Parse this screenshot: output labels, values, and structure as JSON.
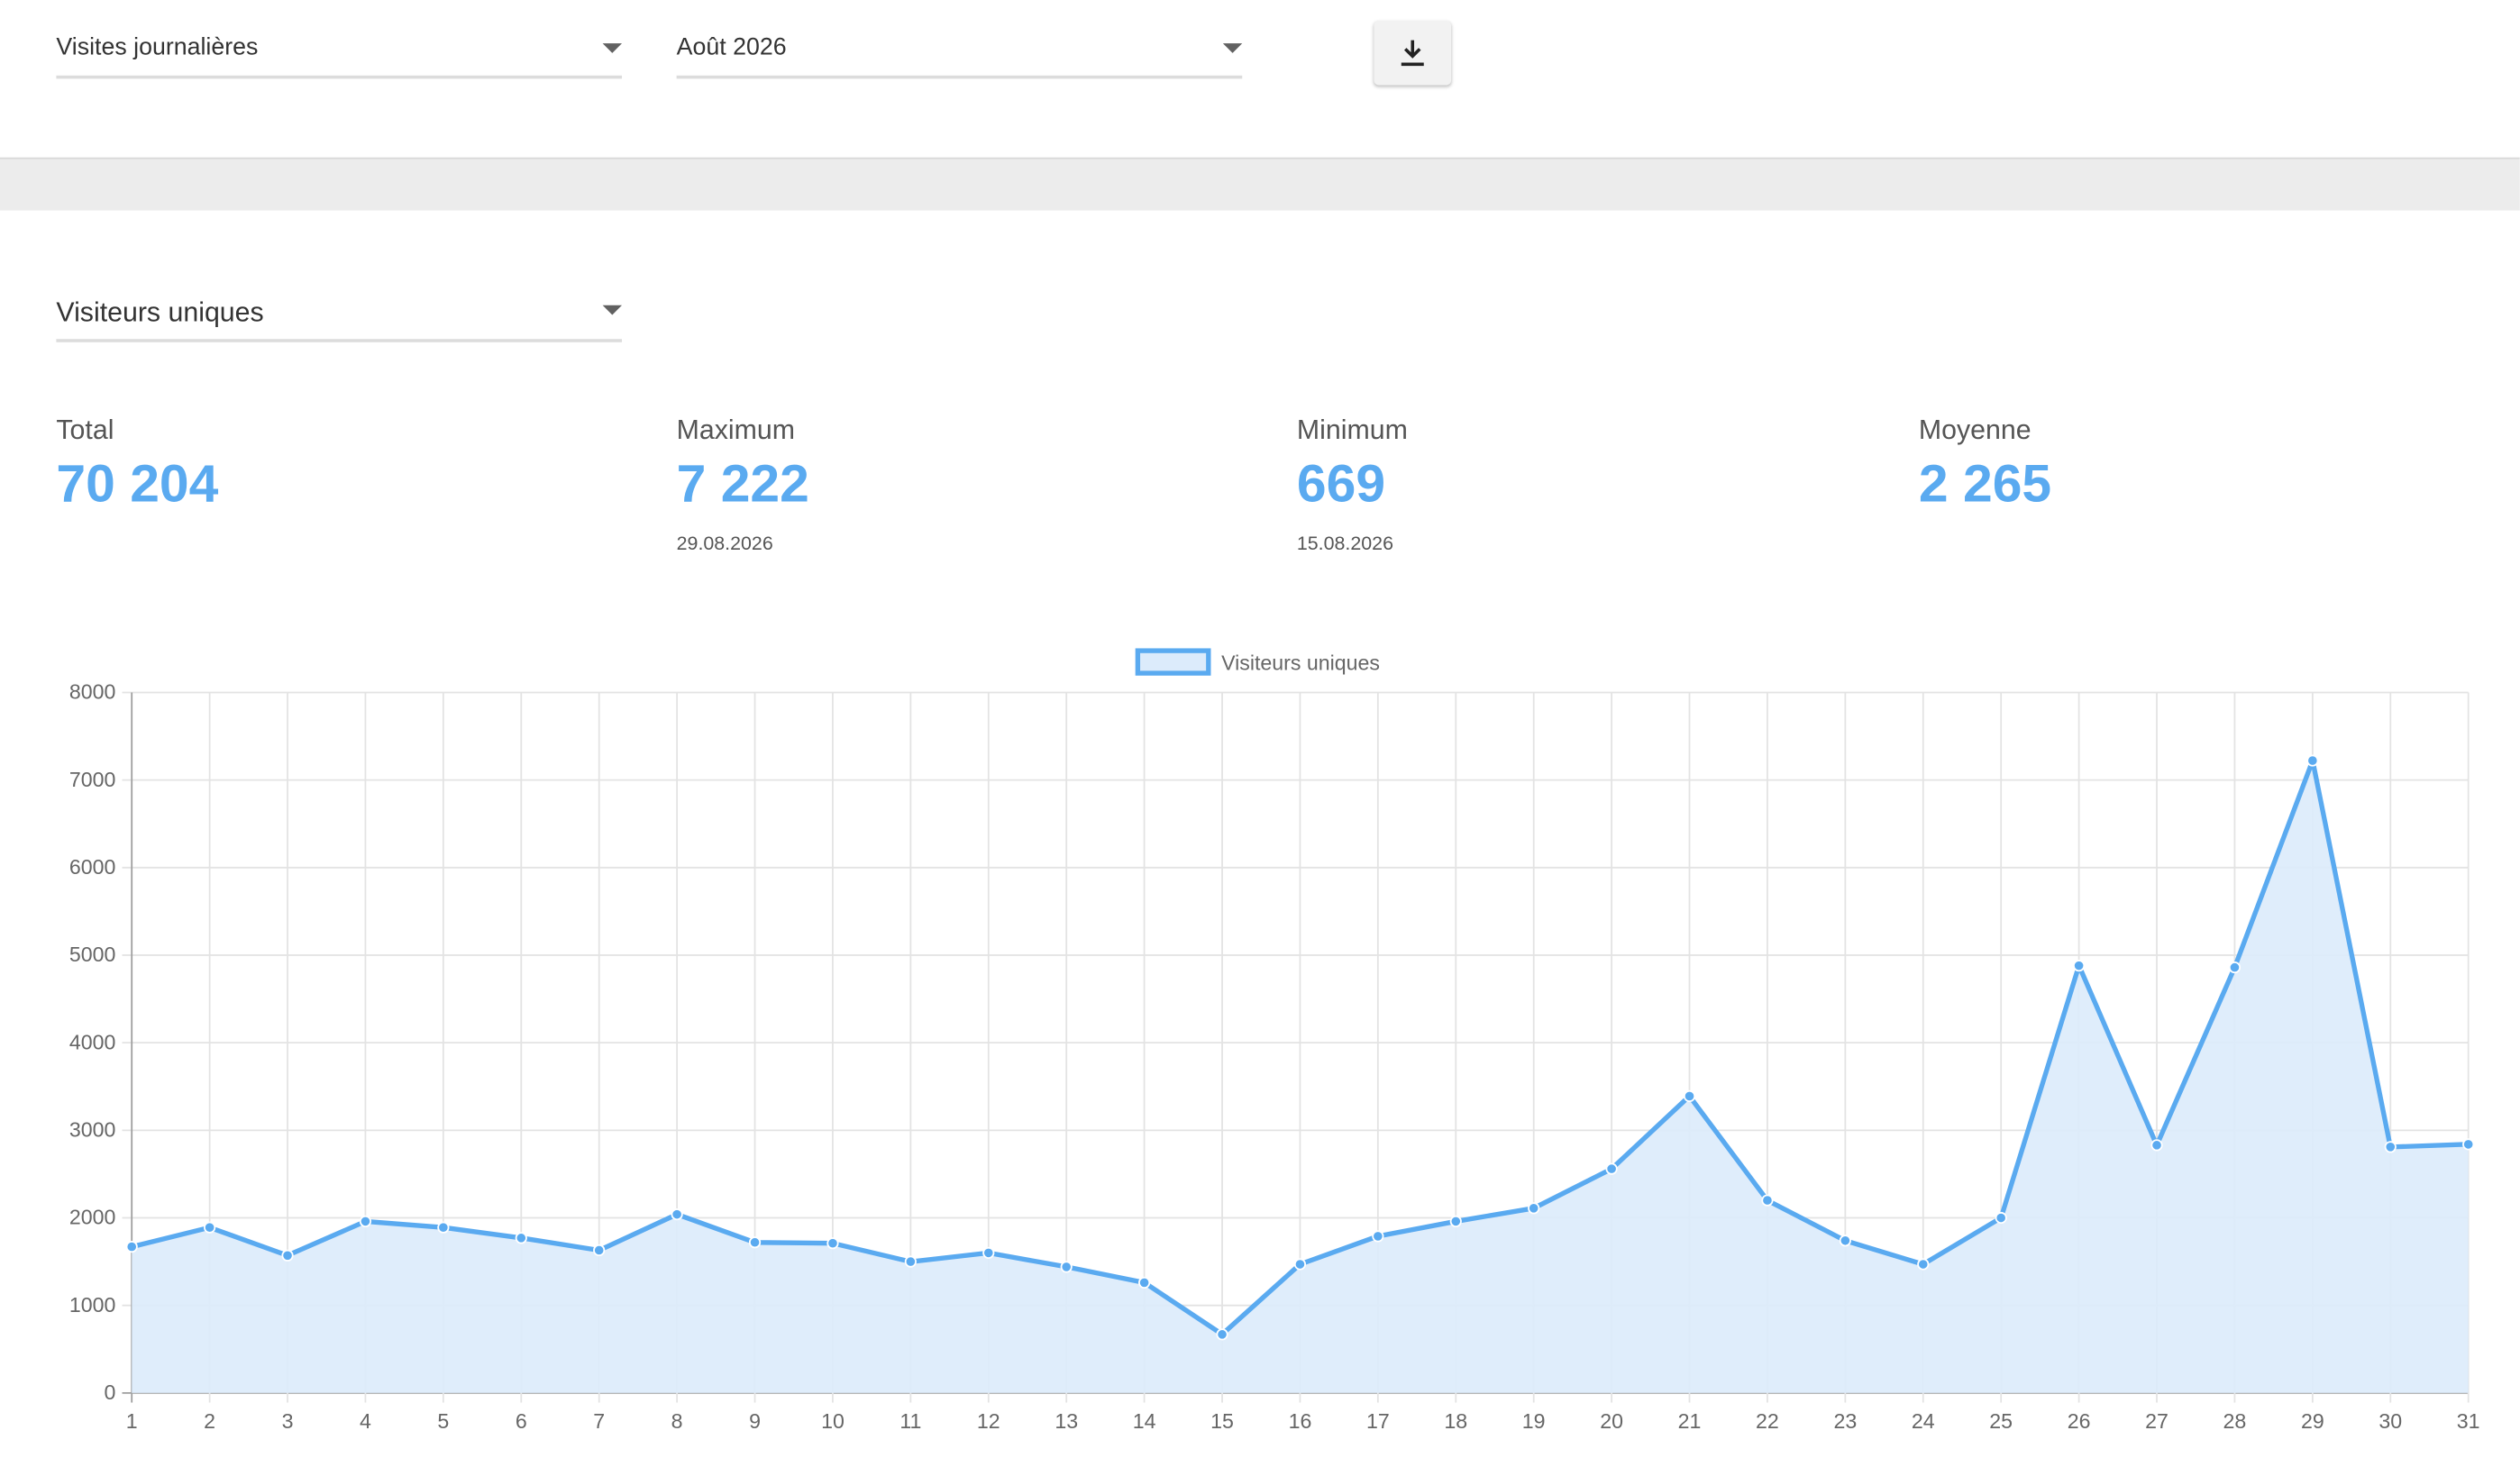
{
  "header": {
    "report_select": "Visites journalières",
    "period_select": "Août 2026",
    "download_icon": "download-icon"
  },
  "metric_select": "Visiteurs uniques",
  "stats": [
    {
      "label": "Total",
      "value": "70 204",
      "date": ""
    },
    {
      "label": "Maximum",
      "value": "7 222",
      "date": "29.08.2026"
    },
    {
      "label": "Minimum",
      "value": "669",
      "date": "15.08.2026"
    },
    {
      "label": "Moyenne",
      "value": "2 265",
      "date": ""
    }
  ],
  "colors": {
    "accent": "#5aaaf0",
    "fill": "#dcebfb",
    "grid": "#e3e3e3"
  },
  "chart_data": {
    "type": "area",
    "categories": [
      1,
      2,
      3,
      4,
      5,
      6,
      7,
      8,
      9,
      10,
      11,
      12,
      13,
      14,
      15,
      16,
      17,
      18,
      19,
      20,
      21,
      22,
      23,
      24,
      25,
      26,
      27,
      28,
      29,
      30,
      31
    ],
    "series": [
      {
        "name": "Visiteurs uniques",
        "values": [
          1670,
          1890,
          1570,
          1960,
          1890,
          1770,
          1630,
          2040,
          1720,
          1710,
          1500,
          1600,
          1440,
          1260,
          669,
          1470,
          1790,
          1960,
          2110,
          2560,
          3390,
          2200,
          1740,
          1470,
          2000,
          4880,
          2830,
          4860,
          7222,
          2810,
          2840
        ]
      }
    ],
    "ylim": [
      0,
      8000
    ],
    "yticks": [
      0,
      1000,
      2000,
      3000,
      4000,
      5000,
      6000,
      7000,
      8000
    ],
    "grid": true,
    "legend": "top-center"
  }
}
